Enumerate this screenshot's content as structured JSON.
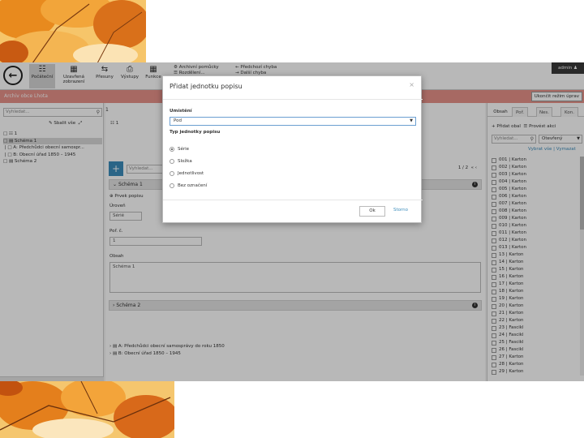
{
  "toolbar": {
    "buttons": [
      {
        "label": "Počáteční",
        "icon": "hierarchy-icon"
      },
      {
        "label": "Uzavřená zobrazení",
        "icon": "grid-icon"
      },
      {
        "label": "Přesuny",
        "icon": "arrows-icon"
      },
      {
        "label": "Výstupy",
        "icon": "printer-icon"
      },
      {
        "label": "Funkce",
        "icon": "calculator-icon"
      }
    ],
    "links_a": [
      "Archivní pomůcky",
      "Rozdělení..."
    ],
    "links_b": [
      "Předchozí chyba",
      "Další chyba"
    ],
    "user": "admin"
  },
  "redbar": {
    "title": "Archiv obce Lhota",
    "exit_label": "Ukončit režim úprav"
  },
  "left": {
    "search_placeholder": "Vyhledat...",
    "collapse_label": "Sbalit vše",
    "tree": [
      "1",
      "Schéma 1",
      "A: Předchůdci obecní samospr...",
      "B: Obecní úřad 1850 – 1945",
      "Schéma 2"
    ]
  },
  "center": {
    "top_value": "1",
    "tree_value": "1",
    "search_placeholder": "Vyhledat...",
    "pager": "1 / 2",
    "section1": "Schéma 1",
    "add_element": "Prvek popisu",
    "level_label": "Úroveň",
    "level_value": "Sérié",
    "order_label": "Poř. č.",
    "order_value": "1",
    "content_label": "Obsah",
    "content_value": "Schéma 1",
    "section2": "Schéma 2",
    "links": [
      "A: Předchůdci obecní samosprávy do roku 1850",
      "B: Obecní úřad 1850 – 1945"
    ]
  },
  "right": {
    "tabs": [
      "Obsah",
      "Poř.",
      "Nes.",
      "Kon."
    ],
    "add_label": "Přidat obal",
    "batch_label": "Provést akci",
    "search_placeholder": "Vyhledat...",
    "filter_value": "Otevřený",
    "link_label": "Vybrat vše",
    "link_label2": "Vymazat",
    "items": [
      "001 | Karton",
      "002 | Karton",
      "003 | Karton",
      "004 | Karton",
      "005 | Karton",
      "006 | Karton",
      "007 | Karton",
      "008 | Karton",
      "009 | Karton",
      "010 | Karton",
      "011 | Karton",
      "012 | Karton",
      "013 | Karton",
      "13 | Karton",
      "14 | Karton",
      "15 | Karton",
      "16 | Karton",
      "17 | Karton",
      "18 | Karton",
      "19 | Karton",
      "20 | Karton",
      "21 | Karton",
      "22 | Karton",
      "23 | Fascikl",
      "24 | Fascikl",
      "25 | Fascikl",
      "26 | Fascikl",
      "27 | Karton",
      "28 | Karton",
      "29 | Karton"
    ]
  },
  "modal": {
    "title": "Přidat jednotku popisu",
    "placement_label": "Umístění",
    "placement_value": "Pod",
    "type_label": "Typ jednotky popisu",
    "options": [
      "Série",
      "Složka",
      "Jednotlivost",
      "Bez označení"
    ],
    "selected_option": "Série",
    "ok_label": "Ok",
    "cancel_label": "Storno"
  }
}
